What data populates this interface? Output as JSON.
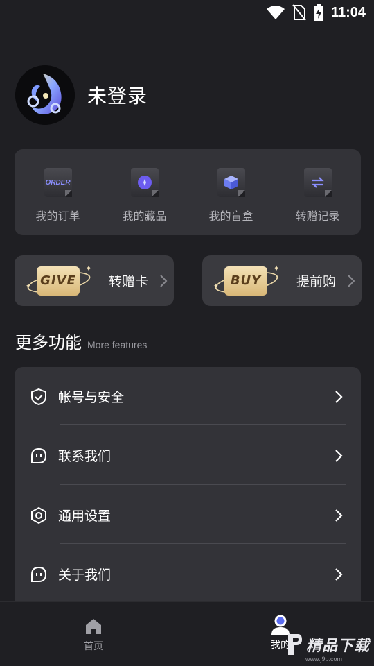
{
  "status_bar": {
    "time": "11:04",
    "icons": [
      "wifi-icon",
      "no-sim-icon",
      "battery-charging-icon"
    ]
  },
  "profile": {
    "username": "未登录",
    "avatar_icon": "dragon-logo-icon"
  },
  "quick_actions": [
    {
      "label": "我的订单",
      "icon": "order-icon",
      "icon_text": "ORDER"
    },
    {
      "label": "我的藏品",
      "icon": "collection-icon"
    },
    {
      "label": "我的盲盒",
      "icon": "blind-box-icon"
    },
    {
      "label": "转赠记录",
      "icon": "transfer-record-icon"
    }
  ],
  "promos": [
    {
      "badge": "GIVE",
      "label": "转赠卡"
    },
    {
      "badge": "BUY",
      "label": "提前购"
    }
  ],
  "more_features": {
    "title": "更多功能",
    "subtitle": "More features",
    "items": [
      {
        "label": "帐号与安全",
        "icon": "shield-check-icon"
      },
      {
        "label": "联系我们",
        "icon": "chat-face-icon"
      },
      {
        "label": "通用设置",
        "icon": "hexagon-settings-icon"
      },
      {
        "label": "关于我们",
        "icon": "chat-face-icon"
      }
    ]
  },
  "bottom_nav": [
    {
      "label": "首页",
      "icon": "home-icon",
      "active": false
    },
    {
      "label": "我的",
      "icon": "profile-icon",
      "active": true
    }
  ],
  "watermark": {
    "text": "精品下载",
    "sub": "www.j9p.com"
  },
  "colors": {
    "background": "#1f1f23",
    "card": "#333338",
    "accent": "#5b6cf0",
    "gold": "#e9d6a8"
  }
}
